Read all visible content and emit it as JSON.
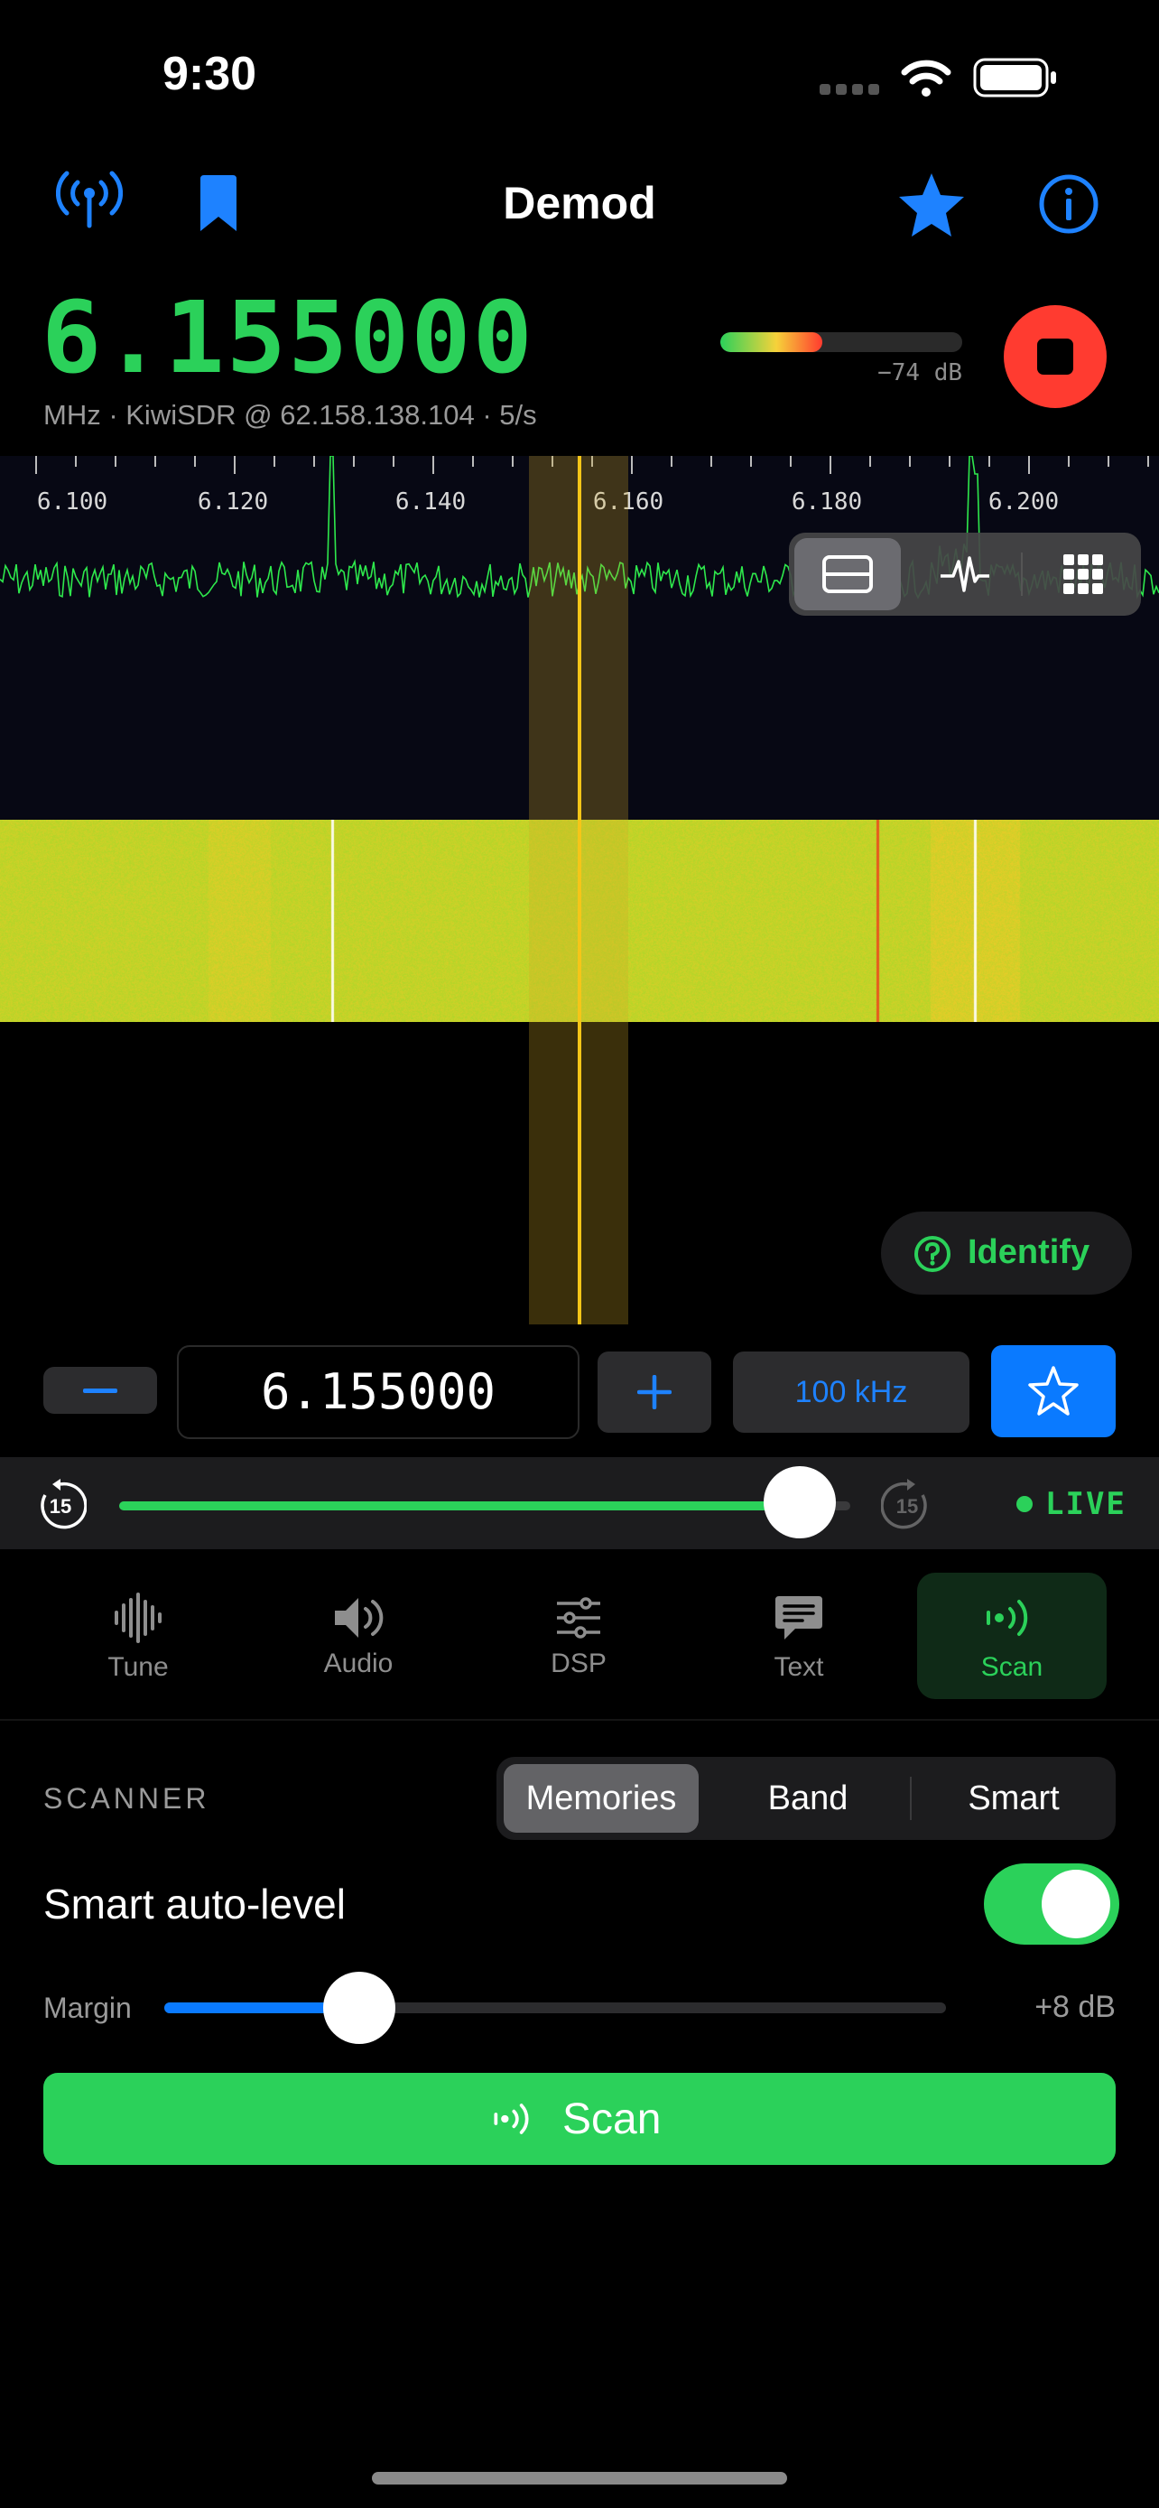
{
  "status_bar": {
    "time": "9:30"
  },
  "nav": {
    "title": "Demod",
    "icons": [
      "antenna-icon",
      "bookmark-icon",
      "star-icon",
      "info-icon"
    ]
  },
  "frequency": {
    "display": "6.155000",
    "subline": "MHz · KiwiSDR @ 62.158.138.104 · 5/s",
    "signal_level_fraction": 0.42,
    "signal_db": "−74  dB"
  },
  "spectrum": {
    "tick_labels": [
      "6.100",
      "6.120",
      "6.140",
      "6.160",
      "6.180",
      "6.200"
    ],
    "view_modes": [
      "split-view-icon",
      "waveform-icon",
      "grid-icon"
    ],
    "selected_view": 0
  },
  "identify_button": {
    "label": "Identify"
  },
  "tuner": {
    "frequency_value": "6.155000",
    "step_label": "100 kHz"
  },
  "timeline": {
    "back_label": "15",
    "forward_label": "15",
    "live_label": "LIVE",
    "position_fraction": 0.93
  },
  "tabs": [
    {
      "label": "Tune",
      "icon": "waveform-icon"
    },
    {
      "label": "Audio",
      "icon": "speaker-icon"
    },
    {
      "label": "DSP",
      "icon": "sliders-icon"
    },
    {
      "label": "Text",
      "icon": "message-icon"
    },
    {
      "label": "Scan",
      "icon": "scan-icon",
      "active": true
    }
  ],
  "scanner": {
    "section_label": "SCANNER",
    "modes": [
      "Memories",
      "Band",
      "Smart"
    ],
    "selected_mode": "Memories",
    "auto_level_label": "Smart auto-level",
    "auto_level_on": true,
    "margin_label": "Margin",
    "margin_value": "+8  dB",
    "margin_fraction": 0.25,
    "scan_button_label": "Scan"
  },
  "colors": {
    "accent_green": "#2bd15a",
    "accent_blue": "#0a7aff",
    "stop_red": "#ff3b30",
    "marker_yellow": "#f5c518"
  }
}
